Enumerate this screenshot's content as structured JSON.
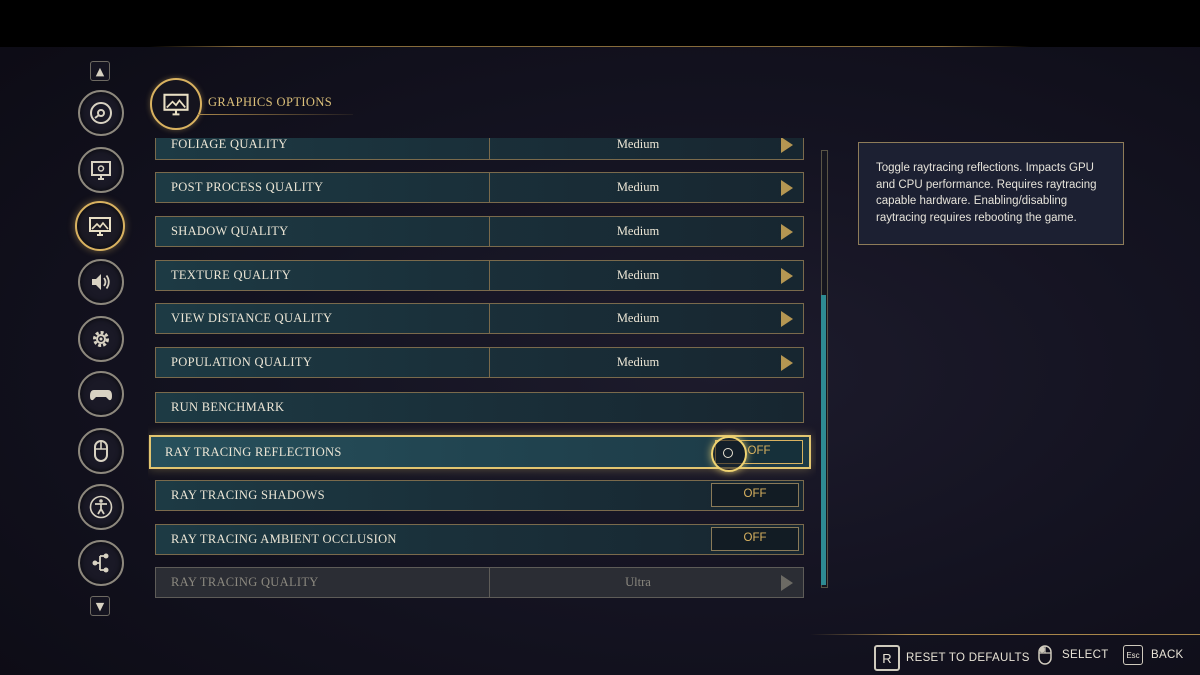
{
  "header": {
    "title": "GRAPHICS OPTIONS",
    "icon": "graphics-icon"
  },
  "rail": {
    "top_cap": "▲",
    "bottom_cap": "▼",
    "items": [
      {
        "icon": "disc-icon",
        "active": false
      },
      {
        "icon": "display-icon",
        "active": false
      },
      {
        "icon": "graphics-icon",
        "active": true
      },
      {
        "icon": "audio-icon",
        "active": false
      },
      {
        "icon": "settings-gear-icon",
        "active": false
      },
      {
        "icon": "gamepad-icon",
        "active": false
      },
      {
        "icon": "mouse-icon",
        "active": false
      },
      {
        "icon": "accessibility-icon",
        "active": false
      },
      {
        "icon": "network-icon",
        "active": false
      }
    ]
  },
  "settings": [
    {
      "label": "FOLIAGE QUALITY",
      "value": "Medium",
      "type": "select"
    },
    {
      "label": "POST PROCESS QUALITY",
      "value": "Medium",
      "type": "select"
    },
    {
      "label": "SHADOW QUALITY",
      "value": "Medium",
      "type": "select"
    },
    {
      "label": "TEXTURE QUALITY",
      "value": "Medium",
      "type": "select"
    },
    {
      "label": "VIEW DISTANCE QUALITY",
      "value": "Medium",
      "type": "select"
    },
    {
      "label": "POPULATION QUALITY",
      "value": "Medium",
      "type": "select"
    },
    {
      "label": "RUN BENCHMARK",
      "type": "action"
    },
    {
      "label": "RAY TRACING REFLECTIONS",
      "value": "OFF",
      "type": "toggle",
      "selected": true
    },
    {
      "label": "RAY TRACING SHADOWS",
      "value": "OFF",
      "type": "toggle"
    },
    {
      "label": "RAY TRACING AMBIENT OCCLUSION",
      "value": "OFF",
      "type": "toggle"
    },
    {
      "label": "RAY TRACING QUALITY",
      "value": "Ultra",
      "type": "select",
      "disabled": true
    }
  ],
  "tooltip": {
    "text": "Toggle raytracing reflections. Impacts GPU and CPU performance. Requires raytracing capable hardware. Enabling/disabling raytracing requires rebooting the game."
  },
  "footer": {
    "reset": {
      "key": "R",
      "label": "RESET TO DEFAULTS"
    },
    "select": {
      "label": "SELECT"
    },
    "back": {
      "key": "Esc",
      "label": "BACK"
    }
  },
  "colors": {
    "gold": "#d9b260",
    "row_bg": "#1d3a44",
    "scrollbar": "#2e8b93"
  }
}
